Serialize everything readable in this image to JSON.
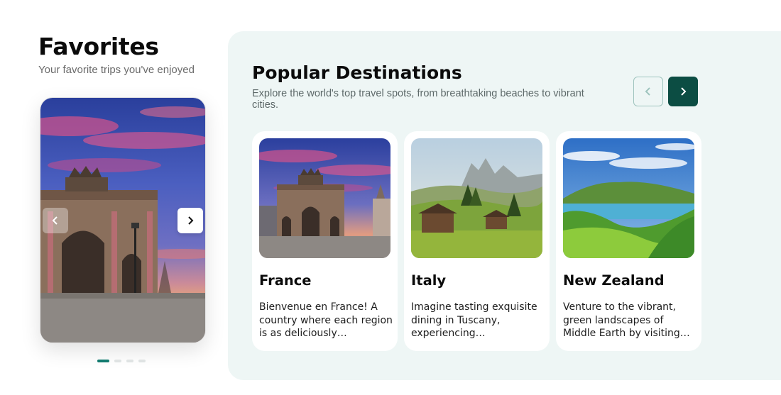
{
  "favorites": {
    "title": "Favorites",
    "subtitle": "Your favorite trips you've enjoyed",
    "prev_icon": "chevron-left-icon",
    "next_icon": "chevron-right-icon",
    "carousel": {
      "total_slides": 4,
      "active_index": 0
    }
  },
  "popular": {
    "title": "Popular Destinations",
    "subtitle": "Explore the world's top travel spots, from breathtaking beaches to vibrant cities.",
    "prev_icon": "chevron-left-icon",
    "next_icon": "chevron-right-icon",
    "destinations": [
      {
        "name": "France",
        "description": "Bienvenue en France! A country where each region is as deliciously…"
      },
      {
        "name": "Italy",
        "description": "Imagine tasting exquisite dining in Tuscany, experiencing…"
      },
      {
        "name": "New Zealand",
        "description": "Venture to the vibrant, green landscapes of Middle Earth by visiting…"
      }
    ]
  },
  "colors": {
    "accent": "#127a6f",
    "dark_button": "#0c4d43",
    "panel_bg": "#eef6f5"
  }
}
